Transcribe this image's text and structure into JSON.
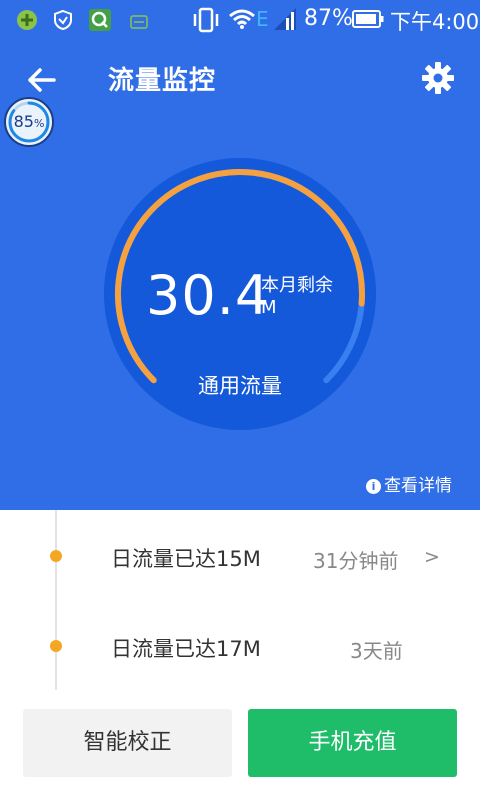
{
  "status_bar": {
    "battery_percent": "87%",
    "time": "下午4:00",
    "network_label": "E",
    "colors": {
      "green_icon": "#8bc34a",
      "network_letter": "#3fb5ff"
    }
  },
  "header": {
    "title": "流量监控",
    "back_icon": "arrow-left-icon",
    "settings_icon": "gear-icon"
  },
  "mini_badge": {
    "value": "85",
    "unit": "%"
  },
  "gauge": {
    "value": "30.4",
    "remain_label": "本月剩余",
    "unit": "M",
    "label": "通用流量",
    "progress": 0.85,
    "colors": {
      "arc": "#f6a13f",
      "track": "#3a7ff0",
      "disc": "#1459d9"
    }
  },
  "details_link": "查看详情",
  "timeline": [
    {
      "text": "日流量已达15M",
      "time": "31分钟前",
      "chevron": ">"
    },
    {
      "text": "日流量已达17M",
      "time": "3天前"
    }
  ],
  "buttons": {
    "calibrate": "智能校正",
    "recharge": "手机充值"
  },
  "colors": {
    "primary": "#2f6ee6",
    "accent": "#f5a623",
    "green": "#1fbd6a"
  }
}
